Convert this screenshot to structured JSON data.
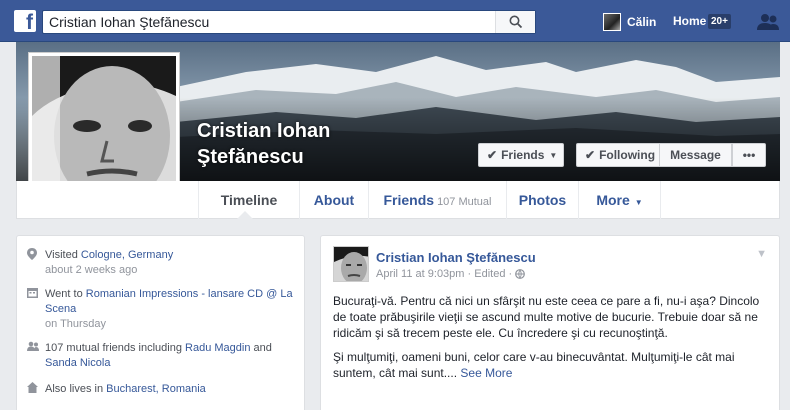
{
  "topbar": {
    "logo": "f",
    "search_value": "Cristian Iohan Ştefănescu",
    "search_icon": "search-icon",
    "user_name": "Călin",
    "home_label": "Home",
    "home_badge": "20+",
    "friend_requests_icon": "friends-icon"
  },
  "profile": {
    "name": "Cristian Iohan Ştefănescu",
    "buttons": {
      "friends": "Friends",
      "following": "Following",
      "message": "Message",
      "more": "•••"
    }
  },
  "nav": {
    "tabs": {
      "timeline": "Timeline",
      "about": "About",
      "friends": "Friends",
      "friends_count": "107 Mutual",
      "photos": "Photos",
      "more": "More"
    }
  },
  "intro": {
    "visited_prefix": "Visited ",
    "visited_place": "Cologne, Germany",
    "visited_time": "about 2 weeks ago",
    "went_prefix": "Went to ",
    "went_event": "Romanian Impressions - lansare CD @ La Scena",
    "went_time": "on Thursday",
    "mutual_prefix": "107 mutual friends including ",
    "mutual_friend1": "Radu Magdin",
    "mutual_and": " and",
    "mutual_friend2": "Sanda Nicola",
    "lives_prefix": "Also lives in ",
    "lives_place": "Bucharest, Romania"
  },
  "post": {
    "author": "Cristian Iohan Ştefănescu",
    "date": "April 11 at 9:03pm",
    "edited": "Edited",
    "paragraph1": "Bucuraţi-vă. Pentru că nici un sfârşit nu este ceea ce pare a fi, nu-i aşa? Dincolo de toate prăbuşirile vieţii se ascund multe motive de bucurie. Trebuie doar să ne ridicăm şi să trecem peste ele. Cu încredere şi cu recunoştinţă.",
    "paragraph2": "Şi mulţumiţi, oameni buni, celor care v-au binecuvântat. Mulţumiţi-le cât mai suntem, cât mai sunt....",
    "see_more": "See More"
  }
}
